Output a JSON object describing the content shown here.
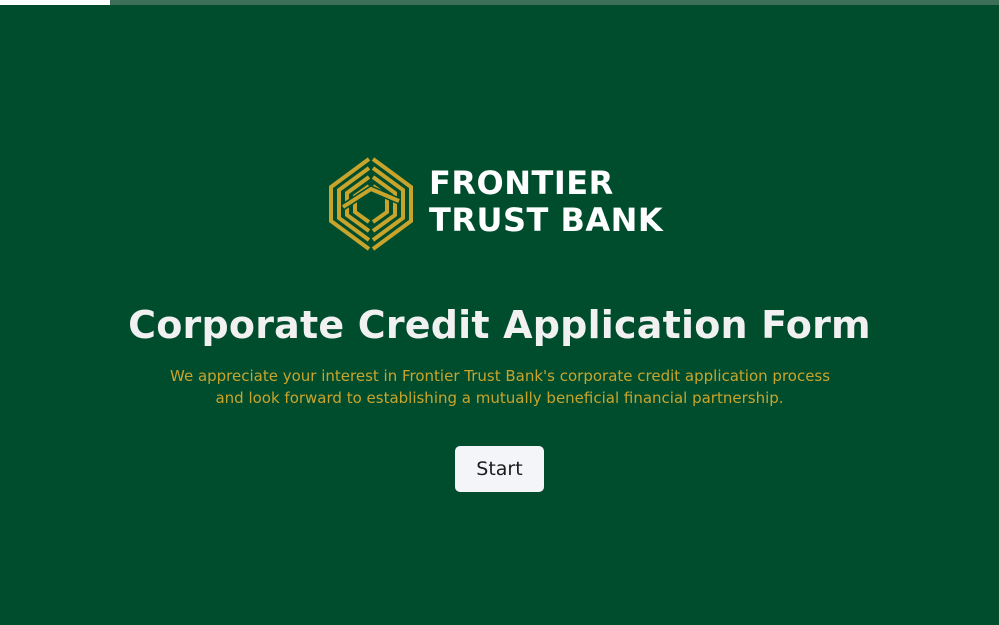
{
  "progress": {
    "value": 0.11
  },
  "brand": {
    "name_line1": "FRONTIER",
    "name_line2": "TRUST BANK",
    "logo_icon": "frontier-chevron-logo-icon",
    "logo_color": "#c9a42c"
  },
  "form": {
    "title": "Corporate Credit Application Form",
    "intro_line1": "We appreciate your interest in Frontier Trust Bank's corporate credit application process",
    "intro_line2": "and look forward to establishing a mutually beneficial financial partnership.",
    "start_label": "Start"
  },
  "colors": {
    "background": "#004d2e",
    "accent": "#c9a42c",
    "title": "#f1f1f1",
    "button_bg": "#f3f5f8"
  }
}
